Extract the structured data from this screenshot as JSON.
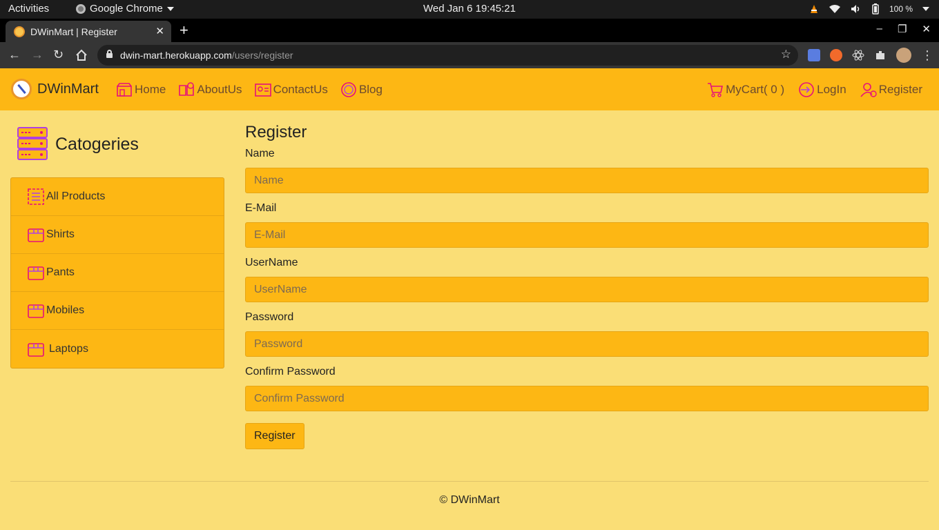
{
  "os": {
    "activities": "Activities",
    "app_name": "Google Chrome",
    "clock": "Wed Jan 6  19:45:21",
    "battery": "100 %"
  },
  "browser": {
    "tab_title": "DWinMart | Register",
    "url_host": "dwin-mart.herokuapp.com",
    "url_path": "/users/register"
  },
  "site": {
    "brand": "DWinMart",
    "nav": [
      {
        "label": "Home"
      },
      {
        "label": "AboutUs"
      },
      {
        "label": "ContactUs"
      },
      {
        "label": "Blog"
      }
    ],
    "nav_right": [
      {
        "label": "MyCart( 0 )"
      },
      {
        "label": "LogIn"
      },
      {
        "label": "Register"
      }
    ]
  },
  "sidebar": {
    "title": "Catogeries",
    "items": [
      {
        "label": "All Products"
      },
      {
        "label": "Shirts"
      },
      {
        "label": "Pants"
      },
      {
        "label": "Mobiles"
      },
      {
        "label": "Laptops"
      }
    ]
  },
  "form": {
    "title": "Register",
    "fields": [
      {
        "label": "Name",
        "placeholder": "Name",
        "value": ""
      },
      {
        "label": "E-Mail",
        "placeholder": "E-Mail",
        "value": ""
      },
      {
        "label": "UserName",
        "placeholder": "UserName",
        "value": ""
      },
      {
        "label": "Password",
        "placeholder": "Password",
        "value": ""
      },
      {
        "label": "Confirm Password",
        "placeholder": "Confirm Password",
        "value": ""
      }
    ],
    "submit_label": "Register"
  },
  "footer": {
    "text": "© DWinMart"
  },
  "colors": {
    "nav_bg": "#fdb714",
    "page_bg": "#fade76",
    "icon_accent": "#e6107a"
  }
}
